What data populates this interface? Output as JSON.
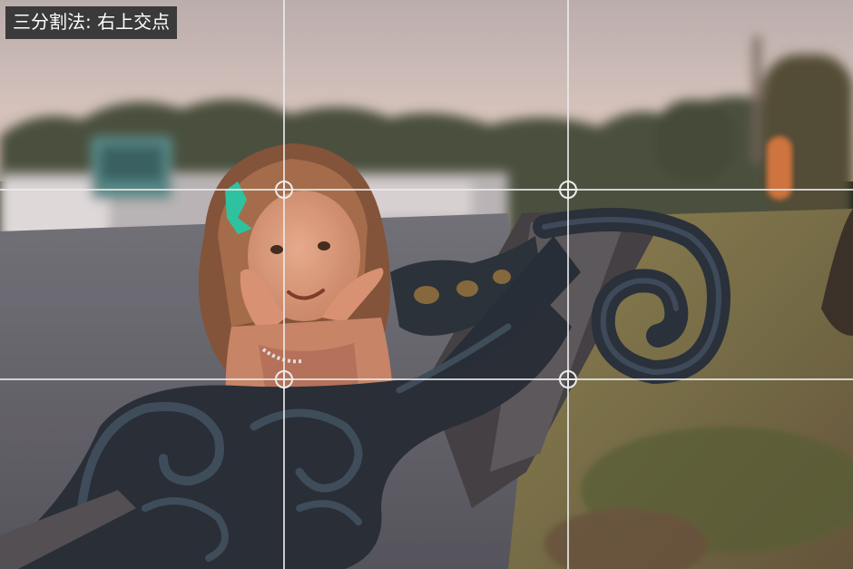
{
  "caption": "三分割法: 右上交点",
  "photo": {
    "subject": "girl-on-ornate-park-bench",
    "palette": {
      "sky": "#d2c3c1",
      "trees": "#3f4a3a",
      "path": "#5a5f6c",
      "grass": "#6f6b45",
      "bench": "#1f2d3a",
      "bow": "#21c7a6",
      "hair": "#8a5a3e",
      "skin": "#d99d80"
    }
  },
  "overlay": {
    "grid_color": "#ebebeb",
    "marker_icon": "crosshair-circle-icon"
  }
}
